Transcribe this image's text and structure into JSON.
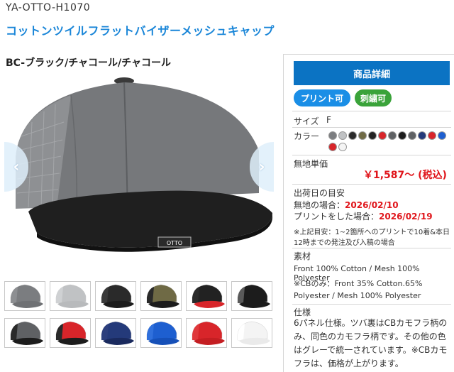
{
  "product": {
    "sku": "YA-OTTO-H1070",
    "title": "コットンツイルフラットバイザーメッシュキャップ",
    "variant": "BC-ブラック/チャコール/チャコール"
  },
  "gallery": {
    "prev_arrow": "‹",
    "next_arrow": "›",
    "tag_text": "OTTO",
    "thumbnails": [
      {
        "crown": "#7b7d80",
        "visor": "#6f7174",
        "mesh": "#8d8f92",
        "bg": "#ffffff"
      },
      {
        "crown": "#c0c2c4",
        "visor": "#b8babc",
        "mesh": "#cfd1d3",
        "bg": "#ffffff"
      },
      {
        "crown": "#2a2a2a",
        "visor": "#1c1c1c",
        "mesh": "#3a3a3a",
        "bg": "#ffffff"
      },
      {
        "crown": "#6f6a45",
        "visor": "#1c1c1c",
        "mesh": "#2a2a2a",
        "bg": "#ffffff"
      },
      {
        "crown": "#222222",
        "visor": "#d8252a",
        "mesh": "#2a2a2a",
        "bg": "#ffffff"
      },
      {
        "crown": "#1c1c1c",
        "visor": "#1c1c1c",
        "mesh": "#5a5a5a",
        "bg": "#ffffff"
      },
      {
        "crown": "#5f6164",
        "visor": "#1c1c1c",
        "mesh": "#2a2a2a",
        "bg": "#ffffff"
      },
      {
        "crown": "#d8252a",
        "visor": "#1c1c1c",
        "mesh": "#2a2a2a",
        "bg": "#ffffff"
      },
      {
        "crown": "#243a7a",
        "visor": "#1a2a5e",
        "mesh": "#2c3f7d",
        "bg": "#ffffff"
      },
      {
        "crown": "#1e5fd0",
        "visor": "#1650b8",
        "mesh": "#3070dc",
        "bg": "#ffffff"
      },
      {
        "crown": "#d8252a",
        "visor": "#c41e22",
        "mesh": "#e0383c",
        "bg": "#ffffff"
      },
      {
        "crown": "#f4f4f4",
        "visor": "#eaeaea",
        "mesh": "#ffffff",
        "bg": "#ffffff"
      }
    ]
  },
  "panel": {
    "detail_button": "商品詳細",
    "badge_print": "プリント可",
    "badge_embroidery": "刺繍可",
    "size_label": "サイズ",
    "size_value": "F",
    "color_label": "カラー",
    "color_swatches": [
      "#7b7d80",
      "#c0c2c4",
      "#2a2a2a",
      "#6f6a45",
      "#222222",
      "#d8252a",
      "#5f6164",
      "#1c1c1c",
      "#5f6164",
      "#243a7a",
      "#d8252a",
      "#1e5fd0",
      "#d8252a",
      "#f4f4f4"
    ],
    "price_label": "無地単価",
    "price": "￥1,587～ (税込)",
    "ship_heading": "出荷日の目安",
    "ship_plain_label": "無地の場合：",
    "ship_plain_date": "2026/02/10",
    "ship_print_label": "プリントをした場合：",
    "ship_print_date": "2026/02/19",
    "ship_note": "※上記目安：1~2箇所へのプリントで10着&本日12時までの発注及び入稿の場合",
    "material_heading": "素材",
    "material_line1": "Front 100% Cotton / Mesh 100% Polyester",
    "material_line2": "※CBのみ：Front 35% Cotton.65%",
    "material_line3": "Polyester / Mesh 100% Polyester",
    "spec_heading": "仕様",
    "spec_text": "6パネル仕様。ツバ裏はCBカモフラ柄のみ、同色のカモフラ柄です。その他の色はグレーで統一されています。※CBカモフラは、価格が上がります。"
  },
  "colors": {
    "accent_blue": "#0b73c3",
    "title_blue": "#1a86d8",
    "price_red": "#e0151b",
    "print_badge": "#1a8ee6",
    "embroidery_badge": "#3aa33a"
  }
}
